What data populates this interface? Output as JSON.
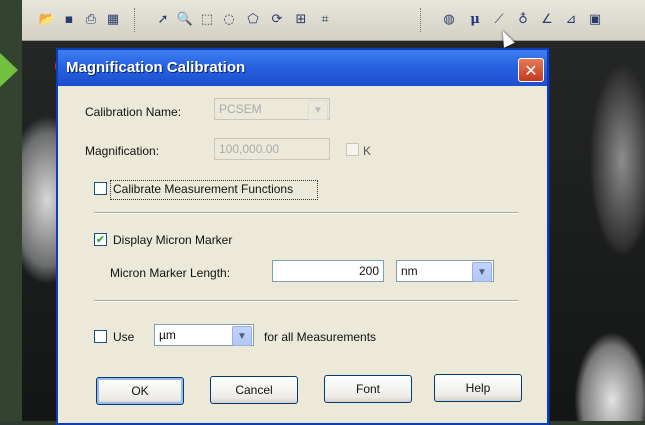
{
  "dialog": {
    "title": "Magnification Calibration",
    "close_glyph": "✕",
    "calibration_name": {
      "label": "Calibration Name:",
      "value": "PCSEM"
    },
    "magnification": {
      "label": "Magnification:",
      "value": "100,000.00",
      "k_label": "K"
    },
    "calibrate_measurement": {
      "label": "Calibrate Measurement Functions",
      "checked": false
    },
    "display_micron_marker": {
      "label": "Display Micron Marker",
      "checked": true,
      "check_glyph": "✔"
    },
    "micron_marker_length": {
      "label": "Micron Marker Length:",
      "value": "200",
      "unit": "nm"
    },
    "use_units": {
      "label": "Use",
      "unit": "µm",
      "suffix": "for all Measurements",
      "checked": false
    },
    "buttons": {
      "ok": "OK",
      "cancel": "Cancel",
      "font": "Font",
      "help": "Help"
    }
  },
  "toolbar": {
    "items": [
      {
        "icon": "open-folder-icon",
        "glyph": "📂"
      },
      {
        "icon": "save-icon",
        "glyph": "▪"
      },
      {
        "icon": "print-icon",
        "glyph": "⎙"
      },
      {
        "icon": "calculator-icon",
        "glyph": "▦"
      },
      {
        "icon": "select-arrow-icon",
        "glyph": "➚"
      },
      {
        "icon": "zoom-icon",
        "glyph": "🔍"
      },
      {
        "icon": "rectangle-select-icon",
        "glyph": "⬚"
      },
      {
        "icon": "ellipse-select-icon",
        "glyph": "◌"
      },
      {
        "icon": "polygon-select-icon",
        "glyph": "⬠"
      },
      {
        "icon": "freehand-select-icon",
        "glyph": "⟳"
      },
      {
        "icon": "grid-select-icon",
        "glyph": "⊞"
      },
      {
        "icon": "crop-icon",
        "glyph": "⌗"
      },
      {
        "icon": "fill-icon",
        "glyph": "◍"
      },
      {
        "icon": "micron-marker-icon",
        "glyph": "μ"
      },
      {
        "icon": "line-measure-icon",
        "glyph": "⟋"
      },
      {
        "icon": "point-icon",
        "glyph": "♁"
      },
      {
        "icon": "angle-icon",
        "glyph": "∠"
      },
      {
        "icon": "angle-measure-icon",
        "glyph": "⊿"
      },
      {
        "icon": "image-icon",
        "glyph": "▣"
      }
    ]
  }
}
